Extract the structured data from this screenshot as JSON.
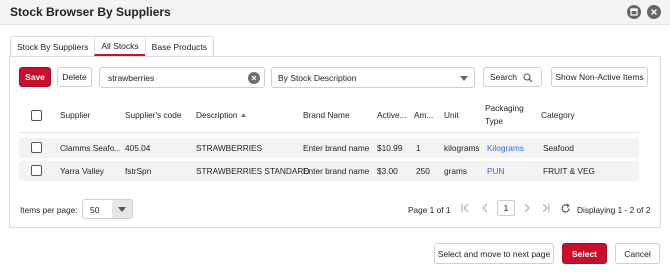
{
  "window": {
    "title": "Stock Browser By Suppliers"
  },
  "tabs": [
    {
      "label": "Stock By Suppliers"
    },
    {
      "label": "All Stocks"
    },
    {
      "label": "Base Products"
    }
  ],
  "toolbar": {
    "save_label": "Save",
    "delete_label": "Delete",
    "search_value": "strawberries",
    "search_by_value": "By Stock Description",
    "search_label": "Search",
    "show_non_active_label": "Show Non-Active Items"
  },
  "table": {
    "columns": [
      "Supplier",
      "Supplier's code",
      "Description",
      "Brand Name",
      "Active...",
      "Am...",
      "Unit",
      "Packaging Type",
      "Category"
    ],
    "sorted_column": "Description",
    "rows": [
      {
        "supplier": "Clamms Seafo...",
        "code": "405.04",
        "description": "STRAWBERRIES",
        "brand": "Enter brand name",
        "active": "$10.99",
        "amount": "1",
        "unit": "kilograms",
        "packaging": "Kilograms",
        "category": "Seafood"
      },
      {
        "supplier": "Yarra Valley",
        "code": "fstrSpn",
        "description": "STRAWBERRIES STANDARD",
        "brand": "Enter brand name",
        "active": "$3.00",
        "amount": "250",
        "unit": "grams",
        "packaging": "PUN",
        "category": "FRUIT & VEG"
      }
    ]
  },
  "pagination": {
    "items_per_page_label": "Items per page:",
    "items_per_page_value": "50",
    "page_info": "Page 1 of 1",
    "current_page": "1",
    "displaying": "Displaying 1 - 2 of 2"
  },
  "footer": {
    "select_next_label": "Select and move to next page",
    "select_label": "Select",
    "cancel_label": "Cancel"
  },
  "colors": {
    "accent": "#c8102e",
    "link": "#2a6fdb"
  }
}
